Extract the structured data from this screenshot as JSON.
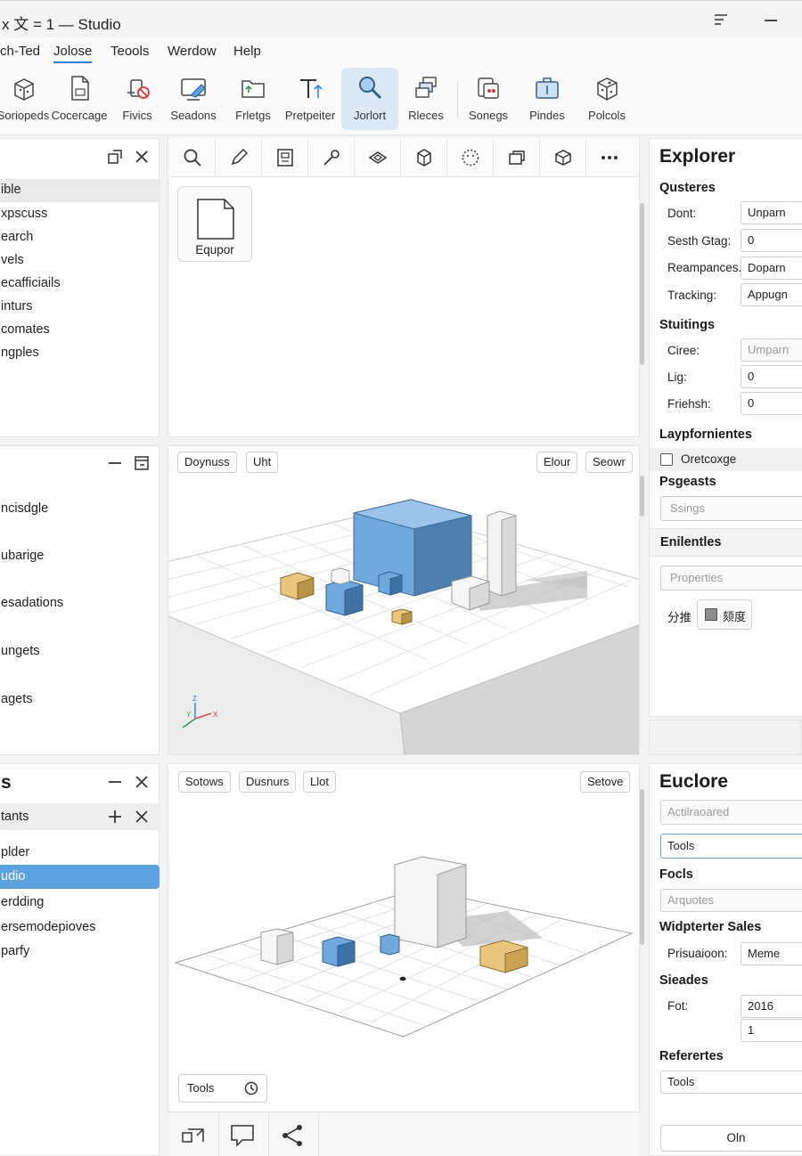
{
  "window": {
    "title": "x 文 = 1 — Studio"
  },
  "menu": [
    "ch-Ted",
    "Jolose",
    "Teools",
    "Werdow",
    "Help"
  ],
  "menu_active_index": 1,
  "ribbon": [
    {
      "label": "Soriореds",
      "icon": "cube-icon"
    },
    {
      "label": "Cocercage",
      "icon": "document-icon"
    },
    {
      "label": "Fivics",
      "icon": "physics-icon"
    },
    {
      "label": "Seadons",
      "icon": "screen-icon"
    },
    {
      "label": "Frletgs",
      "icon": "folder-icon"
    },
    {
      "label": "Pretpeiter",
      "icon": "text-tool-icon"
    },
    {
      "label": "Jorlort",
      "icon": "search-icon"
    },
    {
      "label": "Rleces",
      "icon": "layers-icon"
    },
    {
      "label": "Sonegs",
      "icon": "sound-icon"
    },
    {
      "label": "Pindes",
      "icon": "package-icon"
    },
    {
      "label": "Polcols",
      "icon": "box-icon"
    }
  ],
  "left_top": {
    "items": [
      "ible",
      "xpscuss",
      "earch",
      "vels",
      "ecafficiails",
      "inturs",
      "comates",
      "ngples"
    ]
  },
  "left_mid": {
    "items": [
      "ncisdgle",
      "ubarige",
      "esadations",
      "ungets",
      "agets"
    ]
  },
  "left_bottom": {
    "title": "s",
    "subheader": "tants",
    "items": [
      "plder",
      "udio",
      "erdding",
      "ersemodepioves",
      "parfy"
    ]
  },
  "asset": {
    "label": "Equpor"
  },
  "viewport1": {
    "chips_left": [
      "Doynuss",
      "Uht"
    ],
    "chips_right": [
      "Elour",
      "Seowr"
    ],
    "axis_labels": [
      "Z",
      "Y",
      "X"
    ]
  },
  "viewport2": {
    "chips_left": [
      "Sotows",
      "Dusnurs",
      "Llot"
    ],
    "chips_right": [
      "Setove"
    ],
    "tools_label": "Tools"
  },
  "explorer": {
    "title": "Explorer",
    "section1": "Qusteres",
    "rows1": [
      {
        "label": "Dont:",
        "value": "Unparn"
      },
      {
        "label": "Sesth Gtag:",
        "value": "0"
      },
      {
        "label": "Reampances.",
        "value": "Doparn"
      },
      {
        "label": "Tracking:",
        "value": "Appugn"
      }
    ],
    "section2": "Stuitings",
    "rows2": [
      {
        "label": "Ciree:",
        "value": "Umparn"
      },
      {
        "label": "Lig:",
        "value": "0"
      },
      {
        "label": "Friehsh:",
        "value": "0"
      }
    ],
    "section3": "Laypfornientes",
    "checkbox_label": "Oretcoxge",
    "section4": "Psgeasts",
    "section4_value": "Ssings",
    "section5": "Enilentles",
    "properties_placeholder": "Properties",
    "swatch_left": "分推",
    "swatch_label": "颏度"
  },
  "euclore": {
    "title": "Euclore",
    "field1": "Actilraoared",
    "field2": "Tools",
    "section1": "Focls",
    "field3": "Arquotes",
    "section2": "Widpterter Sales",
    "row1_label": "Prisuaioon:",
    "row1_value": "Meme",
    "section3": "Sieades",
    "row2_label": "Fot:",
    "row2_value_a": "2016",
    "row2_value_b": "1",
    "section4": "Referertes",
    "field4": "Tools",
    "button": "Oln"
  },
  "colors": {
    "accent": "#2b7fd6",
    "selection": "#5aa2e0",
    "cube_blue": "#6fa8dc",
    "cube_tan": "#e8c77d"
  }
}
